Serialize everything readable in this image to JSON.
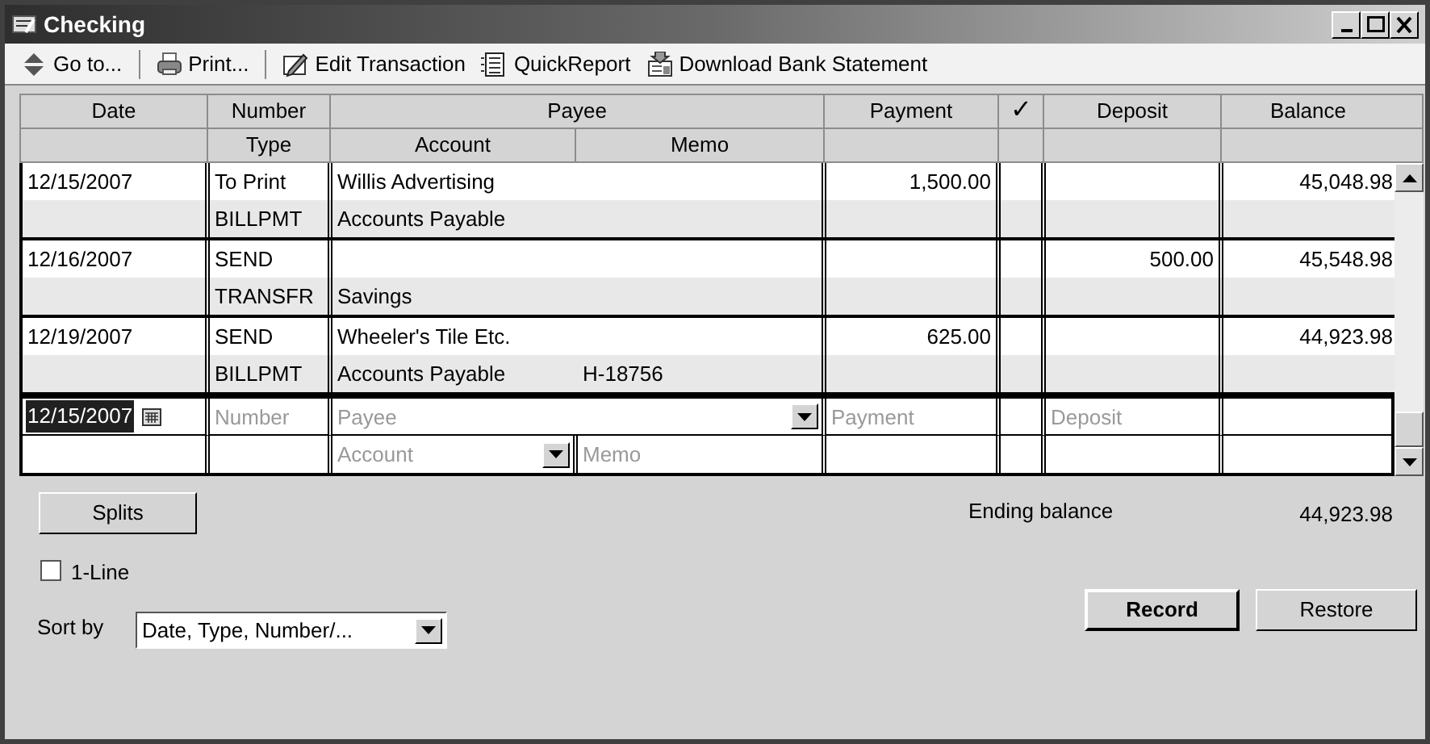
{
  "window": {
    "title": "Checking"
  },
  "toolbar": [
    {
      "kind": "goto",
      "label": "Go to..."
    },
    {
      "kind": "print",
      "label": "Print..."
    },
    {
      "kind": "edit",
      "label": "Edit Transaction"
    },
    {
      "kind": "report",
      "label": "QuickReport"
    },
    {
      "kind": "download",
      "label": "Download Bank Statement"
    }
  ],
  "columns": {
    "line_1": [
      "Date",
      "Number",
      "Payee",
      "Payment",
      "✓",
      "Deposit",
      "Balance"
    ],
    "line_2": [
      "Type",
      "Account",
      "Memo"
    ]
  },
  "transactions": [
    {
      "date": "12/15/2007",
      "number": "To Print",
      "payee": "Willis Advertising",
      "payment": "1,500.00",
      "balance": "45,048.98",
      "type": "BILLPMT",
      "account": "Accounts Payable"
    },
    {
      "date": "12/16/2007",
      "number": "SEND",
      "deposit": "500.00",
      "balance": "45,548.98",
      "type": "TRANSFR",
      "account": "Savings"
    },
    {
      "date": "12/19/2007",
      "number": "SEND",
      "payee": "Wheeler's Tile Etc.",
      "payment": "625.00",
      "balance": "44,923.98",
      "type": "BILLPMT",
      "account": "Accounts Payable",
      "memo": "H-18756"
    }
  ],
  "new_entry": {
    "date": "12/15/2007",
    "number_placeholder": "Number",
    "payee_placeholder": "Payee",
    "payment_placeholder": "Payment",
    "deposit_placeholder": "Deposit",
    "account_placeholder": "Account",
    "memo_placeholder": "Memo"
  },
  "footer": {
    "splits_button": "Splits",
    "ending_balance_label": "Ending balance",
    "ending_balance": "44,923.98",
    "one_line": {
      "label": "1-Line",
      "checked": false
    },
    "sort_by": {
      "label": "Sort by",
      "value": "Date, Type, Number/..."
    },
    "buttons": [
      {
        "kind": "default",
        "label": "Record"
      },
      {
        "kind": "normal",
        "label": "Restore"
      }
    ]
  }
}
